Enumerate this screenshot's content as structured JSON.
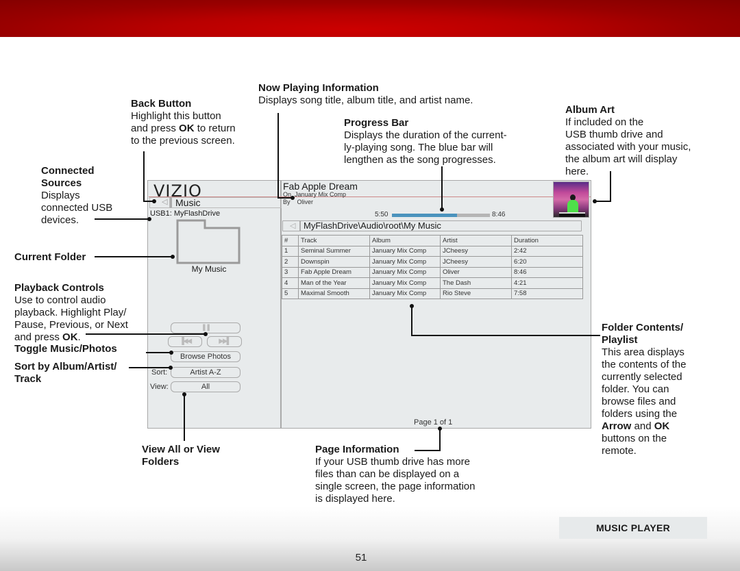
{
  "page": {
    "number": "51",
    "section_tag": "MUSIC PLAYER"
  },
  "annotations": {
    "now_playing": {
      "title": "Now Playing Information",
      "body": "Displays song title, album title, and artist name."
    },
    "back_button": {
      "title": "Back Button",
      "body_1": "Highlight this button",
      "body_2a": "and press ",
      "body_2b": "OK",
      "body_2c": " to return",
      "body_3": "to the previous screen."
    },
    "progress_bar": {
      "title": "Progress Bar",
      "body_1": "Displays the duration of the current-",
      "body_2": "ly-playing song. The blue bar will",
      "body_3": "lengthen as the song progresses."
    },
    "album_art": {
      "title": "Album Art",
      "body_1": "If included on the",
      "body_2": "USB thumb drive and",
      "body_3": "associated with your music,",
      "body_4": "the album art will display",
      "body_5": "here."
    },
    "connected_sources": {
      "title_1": "Connected",
      "title_2": "Sources",
      "body_1": "Displays",
      "body_2": "connected USB",
      "body_3": "devices."
    },
    "current_folder": {
      "title": "Current Folder"
    },
    "playback_controls": {
      "title": "Playback Controls",
      "body_1": "Use to control audio",
      "body_2": "playback. Highlight Play/",
      "body_3": "Pause, Previous, or Next",
      "body_4a": "and press ",
      "body_4b": "OK",
      "body_4c": "."
    },
    "toggle": {
      "title": "Toggle Music/Photos"
    },
    "sort": {
      "title_1": "Sort by Album/Artist/",
      "title_2": "Track"
    },
    "view": {
      "title_1": "View All or View",
      "title_2": "Folders"
    },
    "page_info": {
      "title": "Page Information",
      "body_1": "If your USB thumb drive has more",
      "body_2": "files than can be displayed on a",
      "body_3": "single screen, the page information",
      "body_4": "is displayed here."
    },
    "folder_contents": {
      "title_1": "Folder Contents/",
      "title_2": "Playlist",
      "body_1": "This area displays",
      "body_2": "the contents of the",
      "body_3": "currently selected",
      "body_4": "folder. You can",
      "body_5": "browse files and",
      "body_6": "folders using the",
      "body_7a": "Arrow",
      "body_7b": " and ",
      "body_7c": "OK",
      "body_8": "buttons on the",
      "body_9": "remote."
    }
  },
  "tv_ui": {
    "brand": "VIZIO",
    "back_icon": "◁",
    "nav_title": "Music",
    "source": "USB1: MyFlashDrive",
    "folder_name": "My Music",
    "controls": {
      "play_pause_icon": "❚❚",
      "previous_icon": "▐◀◀",
      "next_icon": "▶▶▌",
      "browse_label": "Browse Photos",
      "sort_label": "Sort:",
      "sort_value": "Artist A-Z",
      "view_label": "View:",
      "view_value": "All"
    },
    "now_playing": {
      "title": "Fab Apple Dream",
      "on_label": "On",
      "album": "January Mix Comp",
      "by_label": "By",
      "artist": "Oliver",
      "elapsed": "5:50",
      "total": "8:46",
      "progress_fraction": 0.665
    },
    "path": "MyFlashDrive\\Audio\\root\\My Music",
    "path_back_icon": "◁",
    "table": {
      "headers": [
        "#",
        "Track",
        "Album",
        "Artist",
        "Duration"
      ],
      "rows": [
        [
          "1",
          "Seminal Summer",
          "January Mix Comp",
          "JCheesy",
          "2:42"
        ],
        [
          "2",
          "Downspin",
          "January Mix Comp",
          "JCheesy",
          "6:20"
        ],
        [
          "3",
          "Fab Apple Dream",
          "January Mix Comp",
          "Oliver",
          "8:46"
        ],
        [
          "4",
          "Man of the Year",
          "January Mix Comp",
          "The Dash",
          "4:21"
        ],
        [
          "5",
          "Maximal Smooth",
          "January Mix Comp",
          "Rio Steve",
          "7:58"
        ]
      ]
    },
    "page_info": "Page 1 of 1"
  }
}
